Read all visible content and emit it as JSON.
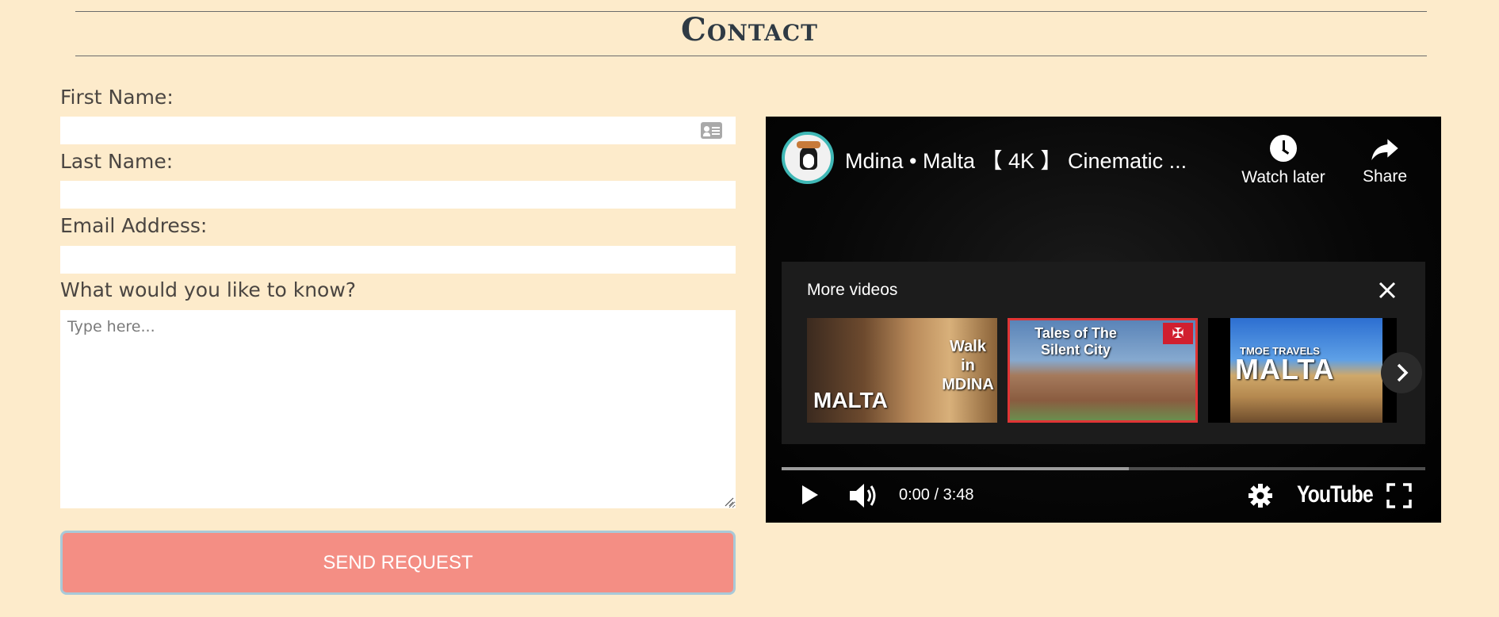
{
  "page": {
    "title": "Contact"
  },
  "form": {
    "first_name_label": "First Name:",
    "last_name_label": "Last Name:",
    "email_label": "Email Address:",
    "message_label": "What would you like to know?",
    "first_name_value": "",
    "last_name_value": "",
    "email_value": "",
    "message_placeholder": "Type here...",
    "submit_label": "SEND REQUEST"
  },
  "video": {
    "title": "Mdina • Malta 【 4K 】 Cinematic ...",
    "watch_later_label": "Watch later",
    "share_label": "Share",
    "more_videos_label": "More videos",
    "thumbnails": [
      {
        "text_main": "MALTA",
        "text_side": "Walk in MDINA"
      },
      {
        "text_main": "Tales of The Silent City",
        "flag": "✠"
      },
      {
        "text_brand": "TMOE TRAVELS",
        "text_main": "MALTA"
      }
    ],
    "time": "0:00 / 3:48",
    "logo": "YouTube",
    "progress_loaded": 0.54
  },
  "colors": {
    "background": "#fdebcb",
    "button": "#f48e84",
    "avatar_ring": "#3fb8b6"
  },
  "icons": [
    "contact-card-icon",
    "clock-icon",
    "share-icon",
    "close-icon",
    "chevron-right-icon",
    "play-icon",
    "volume-icon",
    "gear-icon",
    "fullscreen-icon"
  ]
}
